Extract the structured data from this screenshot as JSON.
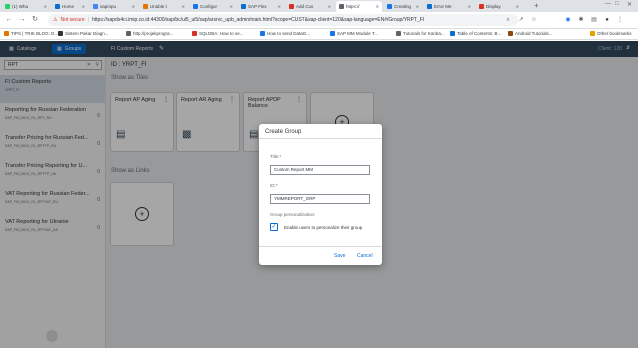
{
  "browser": {
    "tabs": [
      {
        "label": "(1) Wha",
        "color": "#25d366"
      },
      {
        "label": "Home",
        "color": "#0a6ed1"
      },
      {
        "label": "sap/opu",
        "color": "#4285f4"
      },
      {
        "label": "Unable t",
        "color": "#e37400"
      },
      {
        "label": "Configur",
        "color": "#1a73e8"
      },
      {
        "label": "SAP Flex",
        "color": "#0a6ed1"
      },
      {
        "label": "Add Cus",
        "color": "#d93025"
      },
      {
        "label": "https://",
        "color": "#5f6368"
      },
      {
        "label": "Creating",
        "color": "#1a73e8"
      },
      {
        "label": "Error Me",
        "color": "#0a6ed1"
      },
      {
        "label": "Display",
        "color": "#d93025"
      }
    ],
    "active_tab_index": 7,
    "new_tab": "+",
    "not_secure": "Not secure",
    "url": "https://sapds4ci.imip.co.id:44300/sap/bc/ui5_ui5/sap/arsrvc_upb_admn/main.html?scope=CUST&sap-client=120&sap-language=EN#/Group/YRPT_FI",
    "bookmarks": [
      {
        "label": "TIPS | TRIK BLOG: D...",
        "color": "#e37400"
      },
      {
        "label": "Sistem Pakar Diagn...",
        "color": "#333333"
      },
      {
        "label": "http://projekprogra...",
        "color": "#5f6368"
      },
      {
        "label": "SQLDBA: How to se...",
        "color": "#d93025"
      },
      {
        "label": "How to send DataG...",
        "color": "#1a73e8"
      },
      {
        "label": "SAP MM Module T...",
        "color": "#1a73e8"
      },
      {
        "label": "Tutorials for Kanba...",
        "color": "#5f6368"
      },
      {
        "label": "Table of Contents: B...",
        "color": "#0a6ed1"
      },
      {
        "label": "Android Tutorials...",
        "color": "#8a4b08"
      },
      {
        "label": "Other bookmarks",
        "color": "#e3a400"
      }
    ]
  },
  "sidebar": {
    "catalogs_label": "Catalogs",
    "groups_label": "Groups",
    "search_value": "RPT",
    "items": [
      {
        "title": "FI Custom Reports",
        "subtitle": "YRPT_FI",
        "count": ""
      },
      {
        "title": "Reporting for Russian Federation",
        "subtitle": "SAP_FIN_BCG_GL_RPT_RU",
        "count": "6"
      },
      {
        "title": "Transfer Pricing for Russian Fed...",
        "subtitle": "SAP_FIN_BCG_GL_RPTTP_RU",
        "count": "0"
      },
      {
        "title": "Transfer Pricing Reporting for U...",
        "subtitle": "SAP_FIN_BCG_GL_RPTTP_UA",
        "count": "0"
      },
      {
        "title": "VAT Reporting for Russian Feder...",
        "subtitle": "SAP_FIN_BCG_GL_RPTVAT_RU",
        "count": "0"
      },
      {
        "title": "VAT Reporting for Ukraine",
        "subtitle": "SAP_FIN_BCG_GL_RPTVAT_UA",
        "count": "0"
      }
    ]
  },
  "main": {
    "group_title": "FI Custom Reports",
    "client": "Client: 120",
    "id_line": "ID : YRPT_FI",
    "tiles_header": "Show as Tiles",
    "links_header": "Show as Links",
    "tiles": [
      {
        "title": "Report AP Aging"
      },
      {
        "title": "Report AR Aging"
      },
      {
        "title": "Report APDP Balance"
      }
    ]
  },
  "dialog": {
    "title": "Create Group",
    "title_label": "Title:*",
    "title_value": "Custom Report MM",
    "id_label": "ID:*",
    "id_value": "YMMREPORT_GRP",
    "personalization_label": "Group personalization:",
    "checkbox_label": "Enable users to personalize their group",
    "checkbox_checked": true,
    "save_label": "Save",
    "cancel_label": "Cancel"
  }
}
